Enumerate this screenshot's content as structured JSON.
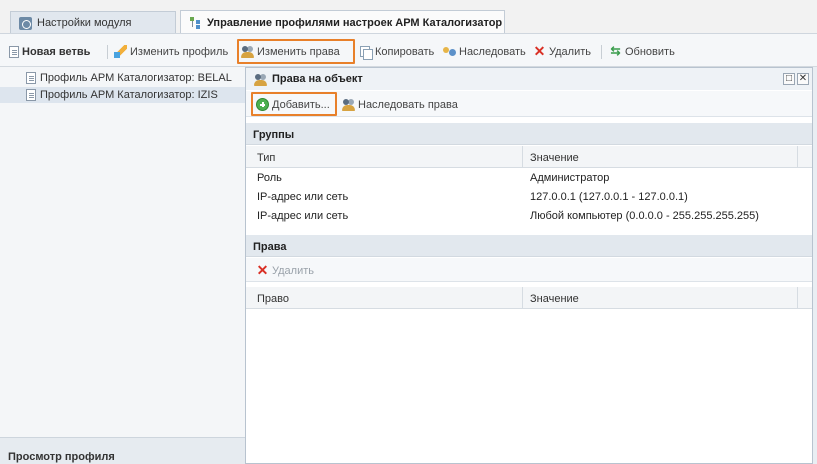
{
  "tabs": [
    {
      "label": "Настройки модуля",
      "icon": "settings-icon"
    },
    {
      "label": "Управление профилями настроек АРМ Каталогизатор",
      "icon": "tree-icon",
      "active": true
    }
  ],
  "toolbar": {
    "new_branch": "Новая ветвь",
    "edit_profile": "Изменить профиль",
    "edit_rights": "Изменить права",
    "copy": "Копировать",
    "inherit": "Наследовать",
    "delete": "Удалить",
    "refresh": "Обновить"
  },
  "tree": {
    "items": [
      {
        "label": "Профиль АРМ Каталогизатор: BELAL"
      },
      {
        "label": "Профиль АРМ Каталогизатор: IZIS",
        "selected": true
      }
    ],
    "footer": "Просмотр профиля"
  },
  "dialog": {
    "title": "Права на объект",
    "add_label": "Добавить...",
    "inherit_rights_label": "Наследовать права",
    "groups": {
      "title": "Группы",
      "columns": [
        "Тип",
        "Значение"
      ],
      "rows": [
        {
          "type": "Роль",
          "value": "Администратор"
        },
        {
          "type": "IP-адрес или сеть",
          "value": "127.0.0.1 (127.0.0.1 - 127.0.0.1)"
        },
        {
          "type": "IP-адрес или сеть",
          "value": "Любой компьютер (0.0.0.0 - 255.255.255.255)"
        }
      ]
    },
    "rights": {
      "title": "Права",
      "delete_label": "Удалить",
      "columns": [
        "Право",
        "Значение"
      ]
    }
  },
  "colors": {
    "highlight": "#e8802a",
    "delete": "#d93025",
    "add": "#4caf50"
  }
}
